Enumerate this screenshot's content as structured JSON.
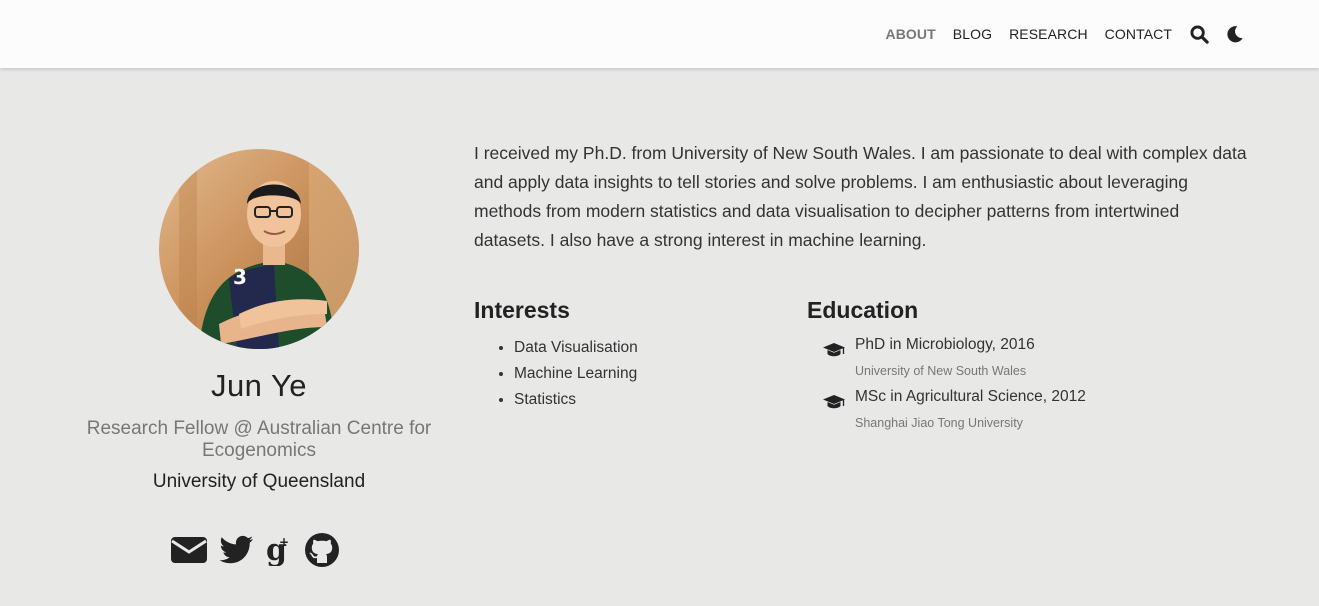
{
  "nav": {
    "items": [
      "ABOUT",
      "BLOG",
      "RESEARCH",
      "CONTACT"
    ],
    "active": "ABOUT",
    "icons": [
      "search-icon",
      "moon-icon"
    ]
  },
  "profile": {
    "name": "Jun Ye",
    "role": "Research Fellow @ Australian Centre for Ecogenomics",
    "organization": "University of Queensland",
    "social_icons": [
      "envelope-icon",
      "twitter-icon",
      "google-scholar-icon",
      "github-icon"
    ]
  },
  "bio": "I received my Ph.D. from University of New South Wales. I am passionate to deal with complex data and apply data insights to tell stories and solve problems. I am enthusiastic about leveraging methods from modern statistics and data visualisation to decipher patterns from intertwined datasets. I also have a strong interest in machine learning.",
  "interests": {
    "title": "Interests",
    "items": [
      "Data Visualisation",
      "Machine Learning",
      "Statistics"
    ]
  },
  "education": {
    "title": "Education",
    "items": [
      {
        "course": "PhD in Microbiology, 2016",
        "institution": "University of New South Wales"
      },
      {
        "course": "MSc in Agricultural Science, 2012",
        "institution": "Shanghai Jiao Tong University"
      }
    ]
  },
  "colors": {
    "background": "#e8e8e7",
    "navbar": "#fcfcfc",
    "text": "#2b2b2b",
    "muted": "#777777"
  }
}
